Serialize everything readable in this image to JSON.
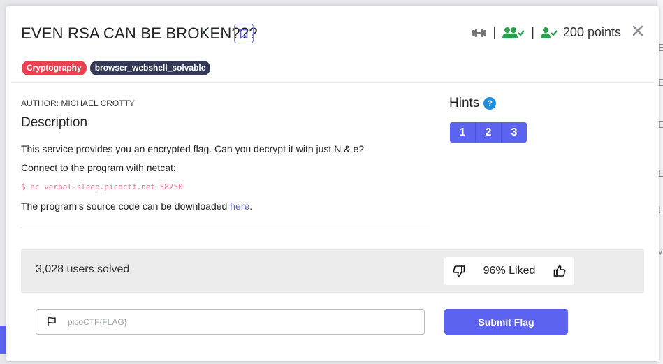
{
  "challenge": {
    "title": "EVEN RSA CAN BE BROKEN???",
    "points_label": "200 points",
    "separator": "|",
    "tags": [
      "Cryptography",
      "browser_webshell_solvable"
    ],
    "author": "AUTHOR: MICHAEL CROTTY",
    "description_heading": "Description",
    "paragraph1": "This service provides you an encrypted flag. Can you decrypt it with just N & e?",
    "paragraph2": "Connect to the program with netcat:",
    "command": "$ nc verbal-sleep.picoctf.net 58750",
    "paragraph3_prefix": "The program's source code can be downloaded ",
    "paragraph3_link": "here",
    "paragraph3_suffix": "."
  },
  "hints": {
    "heading": "Hints",
    "help_glyph": "?",
    "buttons": [
      "1",
      "2",
      "3"
    ]
  },
  "stats": {
    "solved": "3,028 users solved",
    "liked": "96% Liked"
  },
  "flag_form": {
    "placeholder": "picoCTF{FLAG}",
    "submit_label": "Submit Flag"
  },
  "colors": {
    "accent": "#5b63ef",
    "tag_crypto": "#e8414f",
    "tag_browser": "#343a55",
    "green": "#2e9e4f",
    "command": "#e5758e"
  },
  "icons": [
    "bookmark-icon",
    "difficulty-icon",
    "users-check-icon",
    "user-check-icon",
    "close-icon",
    "thumbs-down-icon",
    "thumbs-up-icon",
    "flag-icon",
    "help-icon"
  ]
}
